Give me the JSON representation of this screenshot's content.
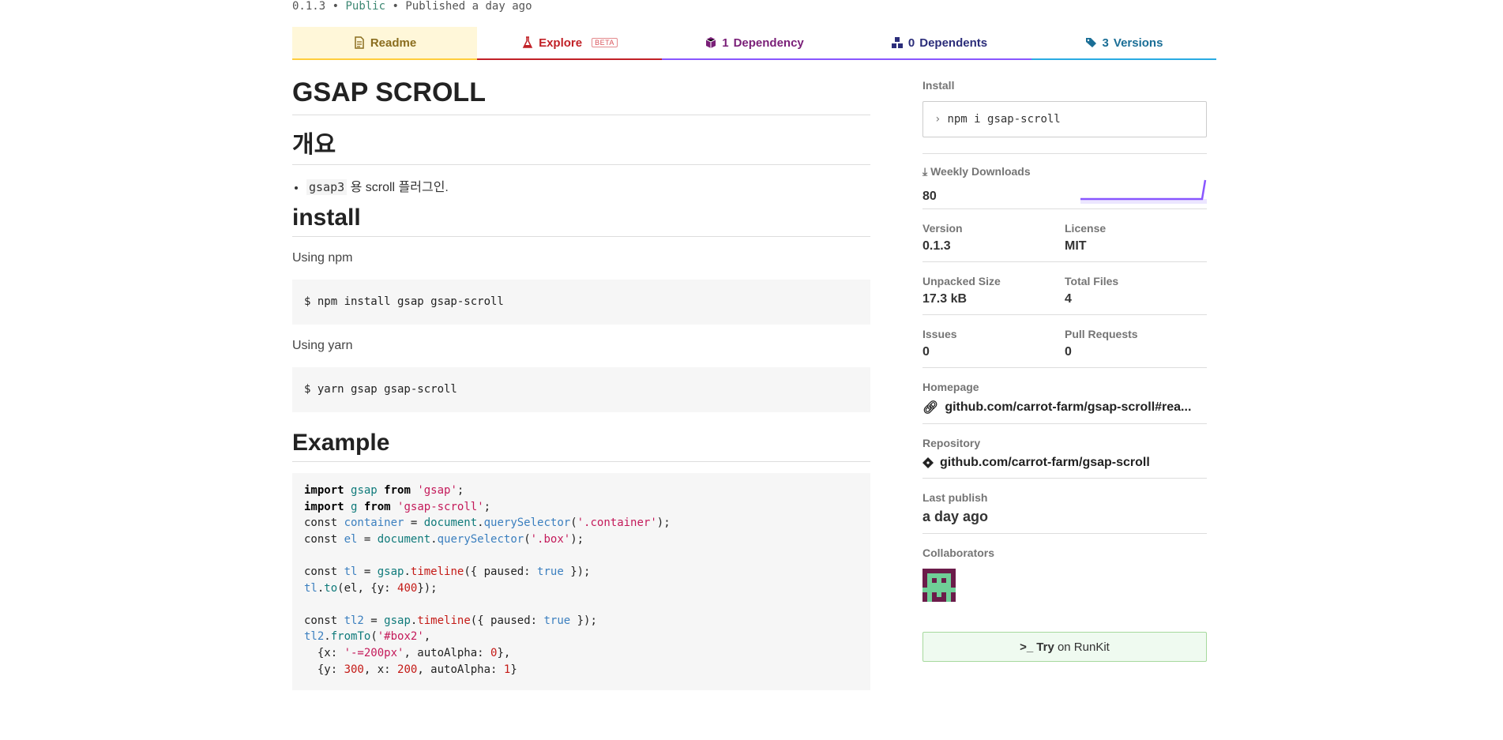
{
  "header": {
    "version": "0.1.3",
    "sep1": "•",
    "visibility": "Public",
    "sep2": "•",
    "published": "Published a day ago"
  },
  "tabs": {
    "readme": "Readme",
    "explore": "Explore",
    "explore_badge": "BETA",
    "dependency_count": "1",
    "dependency_label": "Dependency",
    "dependents_count": "0",
    "dependents_label": "Dependents",
    "versions_count": "3",
    "versions_label": "Versions"
  },
  "readme": {
    "title": "GSAP SCROLL",
    "h_overview": "개요",
    "bullet_code": "gsap3",
    "bullet_text": " 용 scroll 플러그인.",
    "h_install": "install",
    "using_npm": "Using npm",
    "npm_cmd": "$ npm install gsap gsap-scroll",
    "using_yarn": "Using yarn",
    "yarn_cmd": "$ yarn gsap gsap-scroll",
    "h_example": "Example"
  },
  "sidebar": {
    "install_label": "Install",
    "install_cmd": "npm i gsap-scroll",
    "weekly_label": "Weekly Downloads",
    "weekly_value": "80",
    "version_label": "Version",
    "version_value": "0.1.3",
    "license_label": "License",
    "license_value": "MIT",
    "unpacked_label": "Unpacked Size",
    "unpacked_value": "17.3 kB",
    "files_label": "Total Files",
    "files_value": "4",
    "issues_label": "Issues",
    "issues_value": "0",
    "prs_label": "Pull Requests",
    "prs_value": "0",
    "homepage_label": "Homepage",
    "homepage_value": "github.com/carrot-farm/gsap-scroll#rea...",
    "repo_label": "Repository",
    "repo_value": "github.com/carrot-farm/gsap-scroll",
    "lastpub_label": "Last publish",
    "lastpub_value": "a day ago",
    "collab_label": "Collaborators",
    "runkit_try": "Try",
    "runkit_on": " on RunKit"
  },
  "colors": {
    "readme_tab": "#ffcd3c",
    "explore_tab": "#c12127",
    "dependency_tab": "#8956ff",
    "versions_tab": "#29abe2",
    "sparkline": "#8956ff"
  }
}
